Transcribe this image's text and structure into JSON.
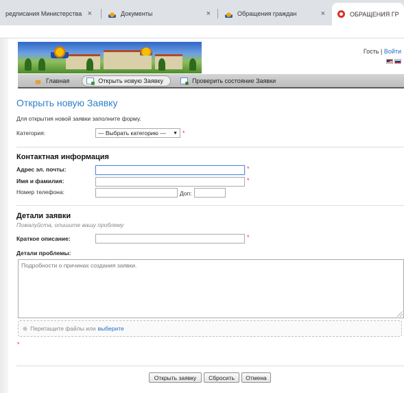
{
  "browser": {
    "tabs": [
      {
        "title": "редписания Министерства об",
        "active": false
      },
      {
        "title": "Документы",
        "active": false
      },
      {
        "title": "Обращения граждан",
        "active": false
      },
      {
        "title": "ОБРАЩЕНИЯ ГРАЖДА",
        "active": true
      }
    ],
    "close_glyph": "×"
  },
  "header": {
    "guest": "Гость",
    "separator": "|",
    "login": "Войти"
  },
  "nav": {
    "items": [
      {
        "label": "Главная",
        "icon": "home-icon",
        "active": false
      },
      {
        "label": "Открыть новую Заявку",
        "icon": "new-ticket-icon",
        "active": true
      },
      {
        "label": "Проверить состояние Заявки",
        "icon": "check-status-icon",
        "active": false
      }
    ]
  },
  "form": {
    "title": "Открыть новую Заявку",
    "intro": "Для открытия новой заявки заполните форму.",
    "category_label": "Категория:",
    "category_value": "— Выбрать категорию —",
    "required_mark": "*",
    "contact_section": "Контактная информация",
    "email_label": "Адрес эл. почты:",
    "email_value": "",
    "name_label": "Имя и фамилия:",
    "name_value": "",
    "phone_label": "Номер телефона:",
    "phone_value": "",
    "ext_label": "Доп:",
    "ext_value": "",
    "details_section": "Детали заявки",
    "details_hint": "Пожалуйста, опишите вашу проблему",
    "summary_label": "Краткое описание:",
    "summary_value": "",
    "problem_label": "Детали проблемы:",
    "problem_placeholder": "Подробности о причинах создания заявки.",
    "dropzone_text": "Перетащите файлы или",
    "dropzone_link": "выберите",
    "dropzone_plus": "⊕"
  },
  "buttons": {
    "open": "Открыть заявку",
    "reset": "Сбросить",
    "cancel": "Отмена"
  }
}
